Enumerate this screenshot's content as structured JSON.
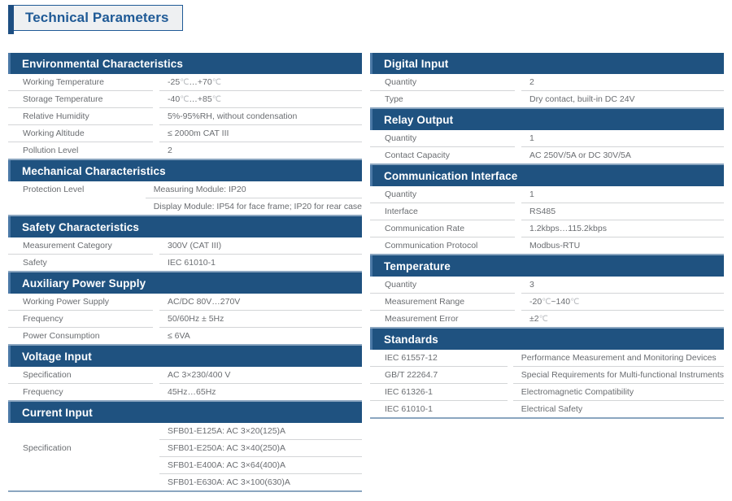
{
  "title": {
    "text": "Technical Parameters"
  },
  "colors": {
    "header_bar": "#1f5280",
    "header_bar_accent": "#4a78a6",
    "title_text": "#1f5a96",
    "title_box_bg": "#eef0f2",
    "block_bottom_rule": "#8ba6c0",
    "row_rule": "#d3d5d7",
    "body_text": "#6a6d71"
  },
  "left_column": [
    {
      "heading": "Environmental Characteristics",
      "rows": [
        {
          "label": "Working Temperature",
          "values": [
            "-25℃…+70℃"
          ]
        },
        {
          "label": "Storage Temperature",
          "values": [
            "-40℃…+85℃"
          ]
        },
        {
          "label": "Relative Humidity",
          "values": [
            "5%-95%RH, without condensation"
          ]
        },
        {
          "label": "Working Altitude",
          "values": [
            "≤ 2000m CAT III"
          ]
        },
        {
          "label": "Pollution Level",
          "values": [
            "2"
          ]
        }
      ]
    },
    {
      "heading": "Mechanical Characteristics",
      "rows": [
        {
          "label": "Protection Level",
          "values": [
            "Measuring Module: IP20",
            "Display Module: IP54 for face frame; IP20 for rear case"
          ]
        }
      ]
    },
    {
      "heading": "Safety Characteristics",
      "rows": [
        {
          "label": "Measurement Category",
          "values": [
            "300V (CAT III)"
          ]
        },
        {
          "label": "Safety",
          "values": [
            "IEC 61010-1"
          ]
        }
      ]
    },
    {
      "heading": "Auxiliary Power Supply",
      "rows": [
        {
          "label": "Working Power Supply",
          "values": [
            "AC/DC 80V…270V"
          ]
        },
        {
          "label": "Frequency",
          "values": [
            "50/60Hz ± 5Hz"
          ]
        },
        {
          "label": "Power Consumption",
          "values": [
            "≤ 6VA"
          ]
        }
      ]
    },
    {
      "heading": "Voltage Input",
      "rows": [
        {
          "label": "Specification",
          "values": [
            "AC 3×230/400 V"
          ]
        },
        {
          "label": "Frequency",
          "values": [
            "45Hz…65Hz"
          ]
        }
      ]
    },
    {
      "heading": "Current Input",
      "rows": [
        {
          "label": "Specification",
          "values": [
            "SFB01-E125A: AC 3×20(125)A",
            "SFB01-E250A: AC 3×40(250)A",
            "SFB01-E400A: AC 3×64(400)A",
            "SFB01-E630A: AC 3×100(630)A"
          ]
        }
      ]
    }
  ],
  "right_column": [
    {
      "heading": "Digital Input",
      "rows": [
        {
          "label": "Quantity",
          "values": [
            "2"
          ]
        },
        {
          "label": "Type",
          "values": [
            "Dry contact, built-in DC 24V"
          ]
        }
      ]
    },
    {
      "heading": "Relay Output",
      "rows": [
        {
          "label": "Quantity",
          "values": [
            "1"
          ]
        },
        {
          "label": "Contact Capacity",
          "values": [
            "AC 250V/5A or DC 30V/5A"
          ]
        }
      ]
    },
    {
      "heading": "Communication Interface",
      "rows": [
        {
          "label": "Quantity",
          "values": [
            "1"
          ]
        },
        {
          "label": "Interface",
          "values": [
            "RS485"
          ]
        },
        {
          "label": "Communication Rate",
          "values": [
            "1.2kbps…115.2kbps"
          ]
        },
        {
          "label": "Communication Protocol",
          "values": [
            "Modbus-RTU"
          ]
        }
      ]
    },
    {
      "heading": "Temperature",
      "rows": [
        {
          "label": "Quantity",
          "values": [
            "3"
          ]
        },
        {
          "label": "Measurement Range",
          "values": [
            "-20℃~140℃"
          ]
        },
        {
          "label": "Measurement Error",
          "values": [
            "±2℃"
          ]
        }
      ]
    },
    {
      "heading": "Standards",
      "rows": [
        {
          "label": "IEC 61557-12",
          "values": [
            "Performance Measurement and Monitoring Devices"
          ]
        },
        {
          "label": "GB/T 22264.7",
          "values": [
            "Special Requirements for Multi-functional Instruments"
          ]
        },
        {
          "label": "IEC 61326-1",
          "values": [
            "Electromagnetic Compatibility"
          ]
        },
        {
          "label": "IEC 61010-1",
          "values": [
            "Electrical Safety"
          ]
        }
      ]
    }
  ]
}
